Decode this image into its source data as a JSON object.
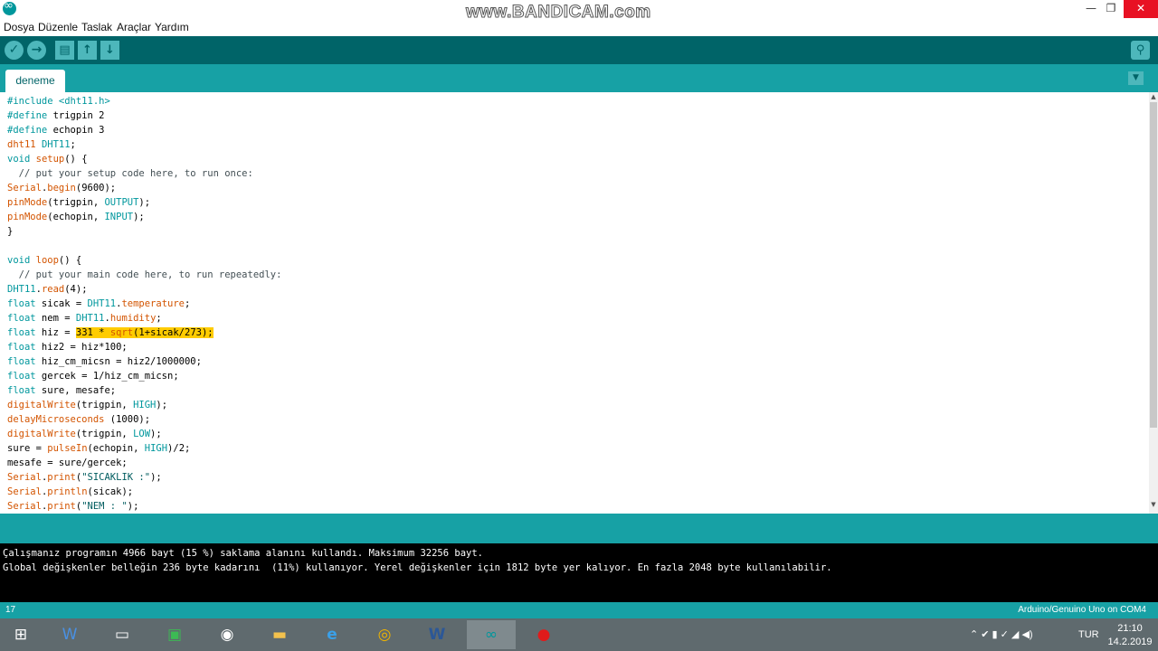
{
  "titlebar": {
    "watermark": "www.BANDICAM.com",
    "minimize": "—",
    "maximize": "❐",
    "close": "✕"
  },
  "menu": [
    "Dosya",
    "Düzenle",
    "Taslak",
    "Araçlar",
    "Yardım"
  ],
  "toolbar": {
    "verify_icon": "✓",
    "upload_icon": "→",
    "new_icon": "▤",
    "open_icon": "↑",
    "save_icon": "↓",
    "serial_monitor_icon": "⚲"
  },
  "tab": {
    "label": "deneme",
    "menu_icon": "▼"
  },
  "code": {
    "l1": [
      "#include <dht11.h>"
    ],
    "l2": [
      "#define",
      " trigpin 2"
    ],
    "l3": [
      "#define",
      " echopin 3"
    ],
    "l4": [
      "dht11",
      " ",
      "DHT11",
      ";"
    ],
    "l5": [
      "void",
      " ",
      "setup",
      "() {"
    ],
    "l6": [
      "  // put your setup code here, to run once:"
    ],
    "l7": [
      "Serial",
      ".",
      "begin",
      "(9600);"
    ],
    "l8": [
      "pinMode",
      "(trigpin, ",
      "OUTPUT",
      ");"
    ],
    "l9": [
      "pinMode",
      "(echopin, ",
      "INPUT",
      ");"
    ],
    "l10": [
      "}"
    ],
    "l11": [
      ""
    ],
    "l12": [
      "void",
      " ",
      "loop",
      "() {"
    ],
    "l13": [
      "  // put your main code here, to run repeatedly:"
    ],
    "l14": [
      "DHT11",
      ".",
      "read",
      "(4);"
    ],
    "l15": [
      "float",
      " sicak = ",
      "DHT11",
      ".",
      "temperature",
      ";"
    ],
    "l16": [
      "float",
      " nem = ",
      "DHT11",
      ".",
      "humidity",
      ";"
    ],
    "l17": [
      "float",
      " hiz = ",
      "331 * ",
      "sqrt",
      "(1+sicak/273);"
    ],
    "l18": [
      "float",
      " hiz2 = hiz*100;"
    ],
    "l19": [
      "float",
      " hiz_cm_micsn = hiz2/1000000;"
    ],
    "l20": [
      "float",
      " gercek = 1/hiz_cm_micsn;"
    ],
    "l21": [
      "float",
      " sure, mesafe;"
    ],
    "l22": [
      "digitalWrite",
      "(trigpin, ",
      "HIGH",
      ");"
    ],
    "l23": [
      "delayMicroseconds",
      " (1000);"
    ],
    "l24": [
      "digitalWrite",
      "(trigpin, ",
      "LOW",
      ");"
    ],
    "l25": [
      "sure = ",
      "pulseIn",
      "(echopin, ",
      "HIGH",
      ")/2;"
    ],
    "l26": [
      "mesafe = sure/gercek;"
    ],
    "l27": [
      "Serial",
      ".",
      "print",
      "(",
      "\"SICAKLIK :\"",
      ");"
    ],
    "l28": [
      "Serial",
      ".",
      "println",
      "(sicak);"
    ],
    "l29": [
      "Serial",
      ".",
      "print",
      "(",
      "\"NEM : \"",
      ");"
    ]
  },
  "console": {
    "line1": "Çalışmanız programın 4966 bayt (15 %) saklama alanını kullandı. Maksimum 32256 bayt.",
    "line2": "Global değişkenler belleğin 236 byte kadarını  (11%) kullanıyor. Yerel değişkenler için 1812 byte yer kalıyor. En fazla 2048 byte kullanılabilir."
  },
  "status": {
    "line_number": "17",
    "board": "Arduino/Genuino Uno on COM4"
  },
  "taskbar": {
    "start_icon": "⊞",
    "apps": [
      "W",
      "▭",
      "▣",
      "◉",
      "▬",
      "e",
      "◎",
      "W",
      "∞",
      "●"
    ],
    "tray_icons": "⌃  ✔  ▮  ✓  ◢  ◀)",
    "language": "TUR",
    "time": "21:10",
    "date": "14.2.2019"
  },
  "colors": {
    "toolbar": "#006468",
    "accent": "#17a1a5",
    "keyword": "#00979d",
    "function": "#d35400",
    "highlight": "#ffcc00"
  }
}
